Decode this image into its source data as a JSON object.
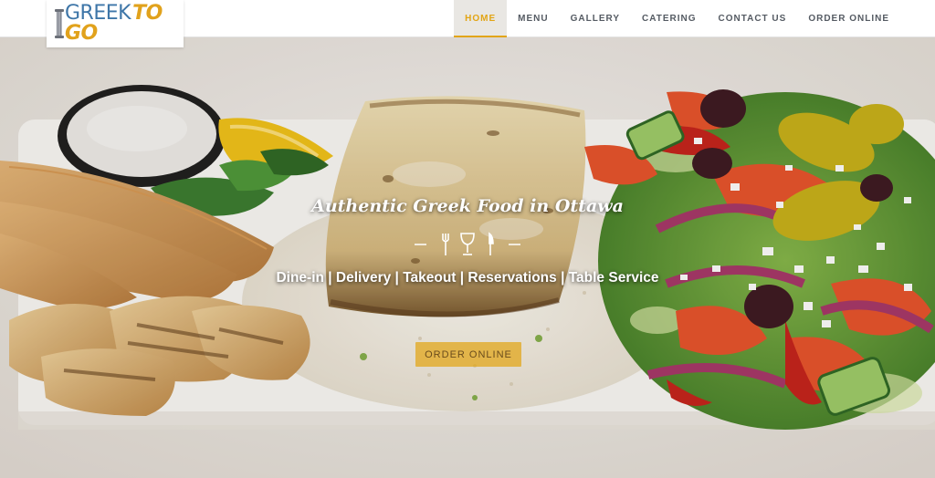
{
  "site": {
    "logo_part1": "GREEK",
    "logo_part2": "TO GO"
  },
  "nav": {
    "items": [
      {
        "label": "HOME",
        "active": true
      },
      {
        "label": "MENU"
      },
      {
        "label": "GALLERY"
      },
      {
        "label": "CATERING"
      },
      {
        "label": "CONTACT US"
      },
      {
        "label": "ORDER ONLINE"
      }
    ]
  },
  "hero": {
    "title": "Authentic Greek Food in Ottawa",
    "subtitle": "Dine-in | Delivery | Takeout | Reservations | Table Service",
    "cta_label": "ORDER ONLINE"
  },
  "colors": {
    "accent": "#e2a515",
    "logo_blue": "#3e76a8",
    "nav_text": "#555b63"
  },
  "icons": [
    "logo-column-icon",
    "fork-icon",
    "wine-glass-icon",
    "knife-icon"
  ]
}
